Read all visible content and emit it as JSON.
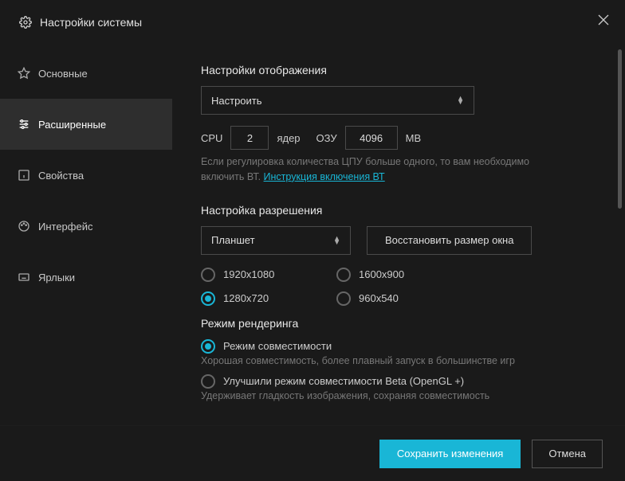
{
  "title": "Настройки системы",
  "sidebar": {
    "items": [
      {
        "label": "Основные"
      },
      {
        "label": "Расширенные"
      },
      {
        "label": "Свойства"
      },
      {
        "label": "Интерфейс"
      },
      {
        "label": "Ярлыки"
      }
    ]
  },
  "display": {
    "heading": "Настройки отображения",
    "dropdown": "Настроить",
    "cpu_label": "CPU",
    "cpu_value": "2",
    "cores_label": "ядер",
    "ram_label": "ОЗУ",
    "ram_value": "4096",
    "mb_label": "MB",
    "hint_pre": "Если регулировка количества ЦПУ больше одного, то вам необходимо включить ВТ. ",
    "hint_link": "Инструкция включения ВТ"
  },
  "resolution": {
    "heading": "Настройка разрешения",
    "dropdown": "Планшет",
    "restore_btn": "Восстановить размер окна",
    "options": [
      {
        "label": "1920x1080",
        "selected": false
      },
      {
        "label": "1600x900",
        "selected": false
      },
      {
        "label": "1280x720",
        "selected": true
      },
      {
        "label": "960x540",
        "selected": false
      }
    ]
  },
  "render": {
    "heading": "Режим рендеринга",
    "opt1": "Режим совместимости",
    "opt1_hint": "Хорошая совместимость, более плавный запуск в большинстве игр",
    "opt2": "Улучшили режим совместимости Beta (OpenGL +)",
    "opt2_hint": "Удерживает гладкость изображения, сохраняя совместимость"
  },
  "footer": {
    "save": "Сохранить изменения",
    "cancel": "Отмена"
  }
}
